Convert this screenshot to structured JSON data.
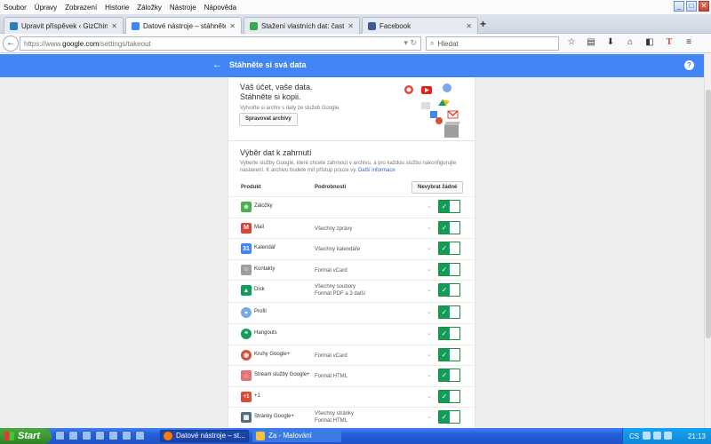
{
  "menubar": {
    "items": [
      "Soubor",
      "Úpravy",
      "Zobrazení",
      "Historie",
      "Záložky",
      "Nástroje",
      "Nápověda"
    ]
  },
  "window_buttons": {
    "minimize": "_",
    "maximize": "□",
    "close": "✕"
  },
  "tabs": [
    {
      "title": "Upravit příspěvek ‹ GizChina.cz – ...",
      "color": "#2a7fbf"
    },
    {
      "title": "Datové nástroje – stáhněte si...",
      "color": "#4285f4"
    },
    {
      "title": "Stažení vlastních dat: časté d...",
      "color": "#34a853"
    },
    {
      "title": "Facebook",
      "color": "#3b5998"
    }
  ],
  "newtab": "+",
  "address": {
    "prefix": "https://www.",
    "domain": "google.com",
    "path": "/settings/takeout"
  },
  "search": {
    "placeholder": "Hledat"
  },
  "toolbar_icons": [
    "star-icon",
    "clipboard-icon",
    "download-icon",
    "home-icon",
    "chat-icon",
    "translate-icon",
    "menu-icon"
  ],
  "translate_letter": "T",
  "appbar": {
    "back": "←",
    "title": "Stáhněte si svá data",
    "help": "?"
  },
  "hero": {
    "line1": "Váš účet, vaše data.",
    "line2": "Stáhněte si kopii.",
    "subtitle": "Vytvořte si archiv s daty ze služeb Google.",
    "manage_button": "Spravovat archivy"
  },
  "section": {
    "title": "Výběr dat k zahrnutí",
    "desc": "Vyberte služby Google, které chcete zahrnout v archivu, a pro každou službu nakonfigurujte nastavení. K archivu budete mít přístup pouze vy.",
    "link": "Další informace"
  },
  "table": {
    "col_product": "Produkt",
    "col_details": "Podrobnosti",
    "deselect_button": "Nevybrat žádné"
  },
  "products": [
    {
      "name": "Záložky",
      "details": "",
      "details2": "",
      "icon": "bookmark-star-icon",
      "color": "#4caf50",
      "glyph": "★"
    },
    {
      "name": "Mail",
      "details": "Všechny zprávy",
      "details2": "",
      "icon": "gmail-icon",
      "color": "#db4437",
      "glyph": "M"
    },
    {
      "name": "Kalendář",
      "details": "Všechny kalendáře",
      "details2": "",
      "icon": "calendar-icon",
      "color": "#4285f4",
      "glyph": "31"
    },
    {
      "name": "Kontakty",
      "details": "Formát vCard",
      "details2": "",
      "icon": "contacts-icon",
      "color": "#9e9e9e",
      "glyph": "☺"
    },
    {
      "name": "Disk",
      "details": "Všechny soubory",
      "details2": "Formát PDF a 3 další",
      "icon": "drive-icon",
      "color": "#0f9d58",
      "glyph": "▲"
    },
    {
      "name": "Profil",
      "details": "",
      "details2": "",
      "icon": "profile-icon",
      "color": "#7aa7e8",
      "glyph": "●"
    },
    {
      "name": "Hangouts",
      "details": "",
      "details2": "",
      "icon": "hangouts-icon",
      "color": "#0f9d58",
      "glyph": "❝"
    },
    {
      "name": "Kruhy Google+",
      "details": "Formát vCard",
      "details2": "",
      "icon": "circles-icon",
      "color": "#dd4b39",
      "glyph": "◉"
    },
    {
      "name": "Stream služby Google+",
      "details": "Formát HTML",
      "details2": "",
      "icon": "stream-home-icon",
      "color": "#e57373",
      "glyph": "⌂"
    },
    {
      "name": "+1",
      "details": "",
      "details2": "",
      "icon": "plusone-icon",
      "color": "#dd4b39",
      "glyph": "+1"
    },
    {
      "name": "Stránky Google+",
      "details": "Všechny stránky",
      "details2": "Formát HTML",
      "icon": "pages-icon",
      "color": "#546e7a",
      "glyph": "▦"
    }
  ],
  "toggle_check": "✓",
  "chevron": "⌄",
  "taskbar": {
    "start": "Start",
    "tasks": [
      {
        "label": "Datové nástroje – st...",
        "color": "#ff7a00"
      },
      {
        "label": "Za - Malování",
        "color": "#f3c43b"
      }
    ],
    "tray": {
      "lang": "CS",
      "clock": "21:13"
    }
  }
}
